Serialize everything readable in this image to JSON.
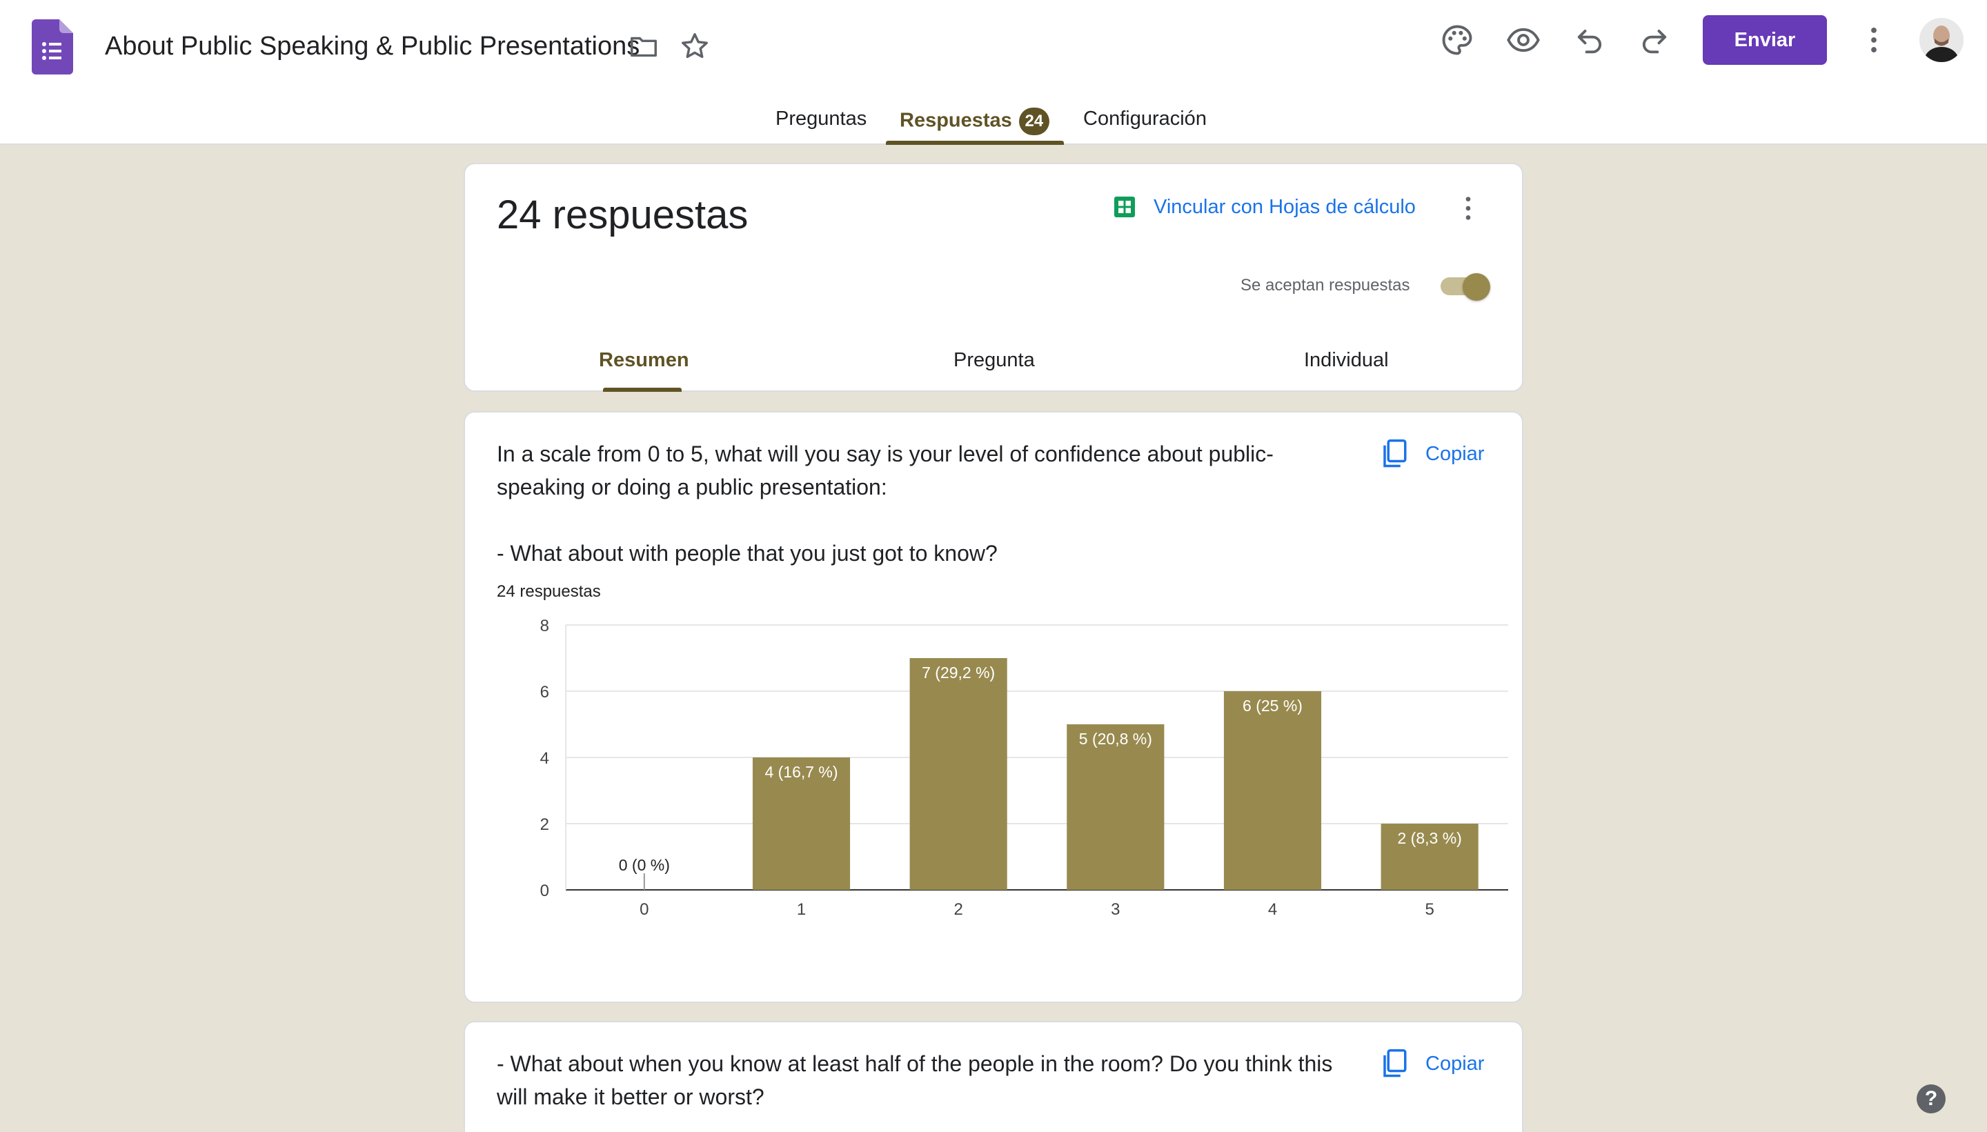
{
  "header": {
    "title": "About Public Speaking & Public Presentations",
    "send_label": "Enviar"
  },
  "tabs": [
    {
      "label": "Preguntas"
    },
    {
      "label": "Respuestas",
      "badge": "24"
    },
    {
      "label": "Configuración"
    }
  ],
  "summary": {
    "count_label": "24 respuestas",
    "sheets_link": "Vincular con Hojas de cálculo",
    "accepting_label": "Se aceptan respuestas",
    "accepting": true,
    "subtabs": [
      "Resumen",
      "Pregunta",
      "Individual"
    ]
  },
  "questions": [
    {
      "title": "In a scale from 0 to 5, what will you say is your level of confidence about public-speaking or doing a public presentation:\n\n- What about with people that you just got to know?",
      "count": "24 respuestas",
      "copy_label": "Copiar"
    },
    {
      "title": "- What about when you know at least half of the people in the room? Do you think this will make it better or worst?",
      "copy_label": "Copiar"
    }
  ],
  "chart_data": {
    "type": "bar",
    "categories": [
      "0",
      "1",
      "2",
      "3",
      "4",
      "5"
    ],
    "values": [
      0,
      4,
      7,
      5,
      6,
      2
    ],
    "data_labels": [
      "0 (0 %)",
      "4 (16,7 %)",
      "7 (29,2 %)",
      "5 (20,8 %)",
      "6 (25 %)",
      "2 (8,3 %)"
    ],
    "ylim": [
      0,
      8
    ],
    "yticks": [
      "0",
      "2",
      "4",
      "6",
      "8"
    ],
    "grid": true,
    "bar_color": "#988a4f"
  },
  "colors": {
    "accent": "#673ab7",
    "theme": "#5f5326",
    "background": "#e6e2d5",
    "link": "#1a73e8"
  },
  "help_label": "?"
}
